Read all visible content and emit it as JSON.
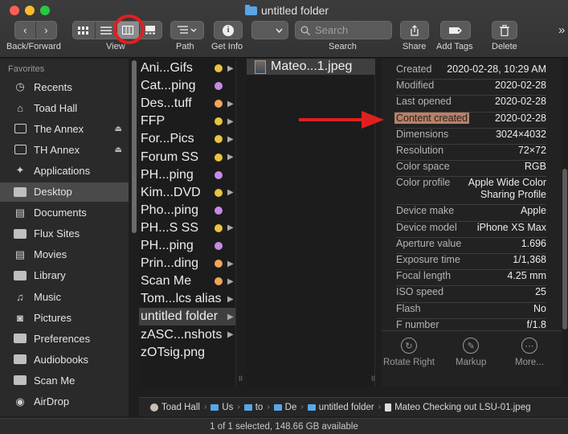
{
  "window": {
    "title": "untitled folder"
  },
  "toolbar": {
    "back_forward_label": "Back/Forward",
    "view_label": "View",
    "path_label": "Path",
    "get_info_label": "Get Info",
    "search_placeholder": "Search",
    "search_label": "Search",
    "share_label": "Share",
    "add_tags_label": "Add Tags",
    "delete_label": "Delete",
    "overflow": "»"
  },
  "sidebar": {
    "heading": "Favorites",
    "items": [
      {
        "label": "Recents",
        "icon": "clock-icon"
      },
      {
        "label": "Toad Hall",
        "icon": "home-icon"
      },
      {
        "label": "The Annex",
        "icon": "drive-icon",
        "eject": true
      },
      {
        "label": "TH Annex",
        "icon": "drive-icon",
        "eject": true
      },
      {
        "label": "Applications",
        "icon": "applications-icon"
      },
      {
        "label": "Desktop",
        "icon": "desktop-icon",
        "selected": true
      },
      {
        "label": "Documents",
        "icon": "document-icon"
      },
      {
        "label": "Flux Sites",
        "icon": "folder-icon"
      },
      {
        "label": "Movies",
        "icon": "film-icon"
      },
      {
        "label": "Library",
        "icon": "folder-icon"
      },
      {
        "label": "Music",
        "icon": "music-icon"
      },
      {
        "label": "Pictures",
        "icon": "camera-icon"
      },
      {
        "label": "Preferences",
        "icon": "folder-icon"
      },
      {
        "label": "Audiobooks",
        "icon": "folder-icon"
      },
      {
        "label": "Scan Me",
        "icon": "folder-icon"
      },
      {
        "label": "AirDrop",
        "icon": "airdrop-icon"
      }
    ]
  },
  "column1": {
    "items": [
      {
        "name": "Ani...Gifs",
        "dot": "#e9c43c",
        "arrow": true
      },
      {
        "name": "Cat...ping",
        "dot": "#c58ae6",
        "arrow": false
      },
      {
        "name": "Des...tuff",
        "dot": "#f0a65a",
        "arrow": true
      },
      {
        "name": "FFP",
        "dot": "#e9c43c",
        "arrow": true
      },
      {
        "name": "For...Pics",
        "dot": "#e9c43c",
        "arrow": true
      },
      {
        "name": "Forum SS",
        "dot": "#e9c43c",
        "arrow": true
      },
      {
        "name": "PH...ping",
        "dot": "#c58ae6",
        "arrow": false
      },
      {
        "name": "Kim...DVD",
        "dot": "#e9c43c",
        "arrow": true
      },
      {
        "name": "Pho...ping",
        "dot": "#c58ae6",
        "arrow": false
      },
      {
        "name": "PH...S SS",
        "dot": "#e9c43c",
        "arrow": true
      },
      {
        "name": "PH...ping",
        "dot": "#c58ae6",
        "arrow": false
      },
      {
        "name": "Prin...ding",
        "dot": "#f0a65a",
        "arrow": true
      },
      {
        "name": "Scan Me",
        "dot": "#f0a65a",
        "arrow": true
      },
      {
        "name": "Tom...lcs alias",
        "dot": "",
        "arrow": true
      },
      {
        "name": "untitled folder",
        "dot": "",
        "arrow": true,
        "selected": true
      },
      {
        "name": "zASC...nshots",
        "dot": "",
        "arrow": true
      },
      {
        "name": "zOTsig.png",
        "dot": "",
        "arrow": false
      }
    ]
  },
  "column2": {
    "file": "Mateo...1.jpeg"
  },
  "info": {
    "rows": [
      {
        "key": "Created",
        "value": "2020-02-28, 10:29 AM"
      },
      {
        "key": "Modified",
        "value": "2020-02-28"
      },
      {
        "key": "Last opened",
        "value": "2020-02-28"
      },
      {
        "key": "Content created",
        "value": "2020-02-28",
        "highlight": true
      },
      {
        "key": "Dimensions",
        "value": "3024×4032"
      },
      {
        "key": "Resolution",
        "value": "72×72"
      },
      {
        "key": "Color space",
        "value": "RGB"
      },
      {
        "key": "Color profile",
        "value": "Apple Wide Color",
        "value2": "Sharing Profile"
      },
      {
        "key": "Device make",
        "value": "Apple"
      },
      {
        "key": "Device model",
        "value": "iPhone XS Max"
      },
      {
        "key": "Aperture value",
        "value": "1.696"
      },
      {
        "key": "Exposure time",
        "value": "1/1,368"
      },
      {
        "key": "Focal length",
        "value": "4.25 mm"
      },
      {
        "key": "ISO speed",
        "value": "25"
      },
      {
        "key": "Flash",
        "value": "No"
      },
      {
        "key": "F number",
        "value": "f/1.8"
      }
    ],
    "actions": [
      {
        "label": "Rotate Right",
        "icon": "rotate-right-icon"
      },
      {
        "label": "Markup",
        "icon": "markup-icon"
      },
      {
        "label": "More...",
        "icon": "more-icon"
      }
    ]
  },
  "pathbar": {
    "segments": [
      "Toad Hall",
      "Us",
      "to",
      "De",
      "untitled folder",
      "Mateo Checking out LSU-01.jpeg"
    ]
  },
  "status": {
    "text": "1 of 1 selected, 148.66 GB available"
  },
  "colors": {
    "highlight": "#b7816a",
    "annotation": "#e02020"
  }
}
